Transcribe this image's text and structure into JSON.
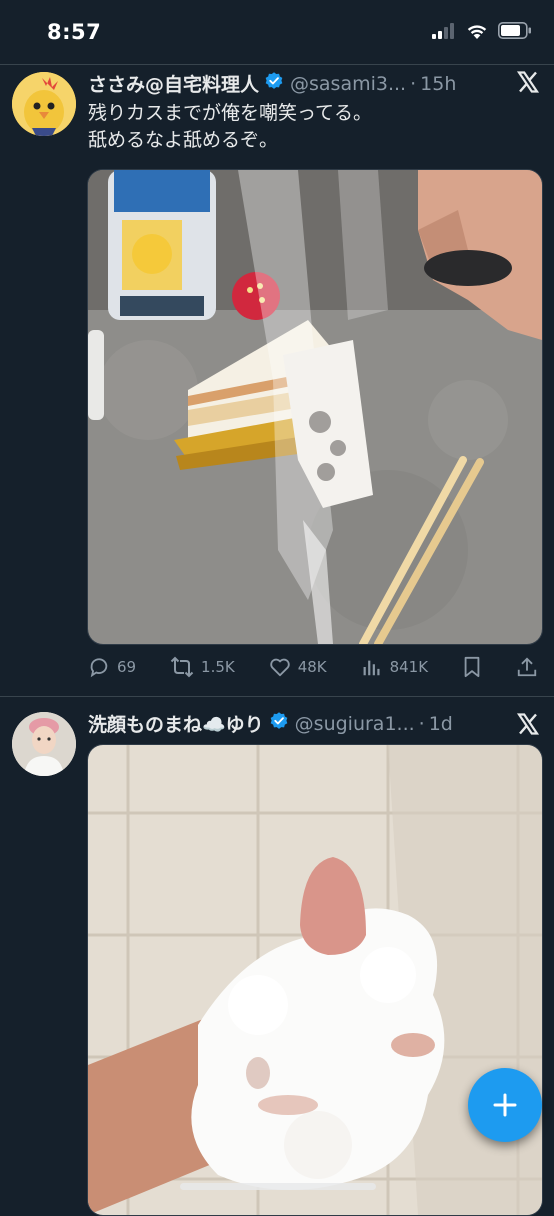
{
  "status_bar": {
    "time": "8:57"
  },
  "tweets": [
    {
      "display_name": "ささみ@自宅料理人",
      "handle": "@sasami3...",
      "separator": "·",
      "age": "15h",
      "text_lines": [
        "残りカスまでが俺を嘲笑ってる。",
        "舐めるなよ舐めるぞ。"
      ],
      "stats": {
        "replies": "69",
        "reposts": "1.5K",
        "likes": "48K",
        "views": "841K"
      }
    },
    {
      "display_name": "洗顔ものまね☁️ゆり",
      "handle": "@sugiura1...",
      "separator": "·",
      "age": "1d"
    }
  ],
  "colors": {
    "background": "#15202b",
    "accent": "#1d9bf0",
    "muted": "#8b98a5",
    "divider": "#38444d"
  },
  "icons": [
    "signal-icon",
    "wifi-icon",
    "battery-icon",
    "verified-badge-icon",
    "x-logo-icon",
    "reply-icon",
    "repost-icon",
    "like-icon",
    "views-icon",
    "bookmark-icon",
    "share-icon",
    "compose-plus-icon"
  ]
}
